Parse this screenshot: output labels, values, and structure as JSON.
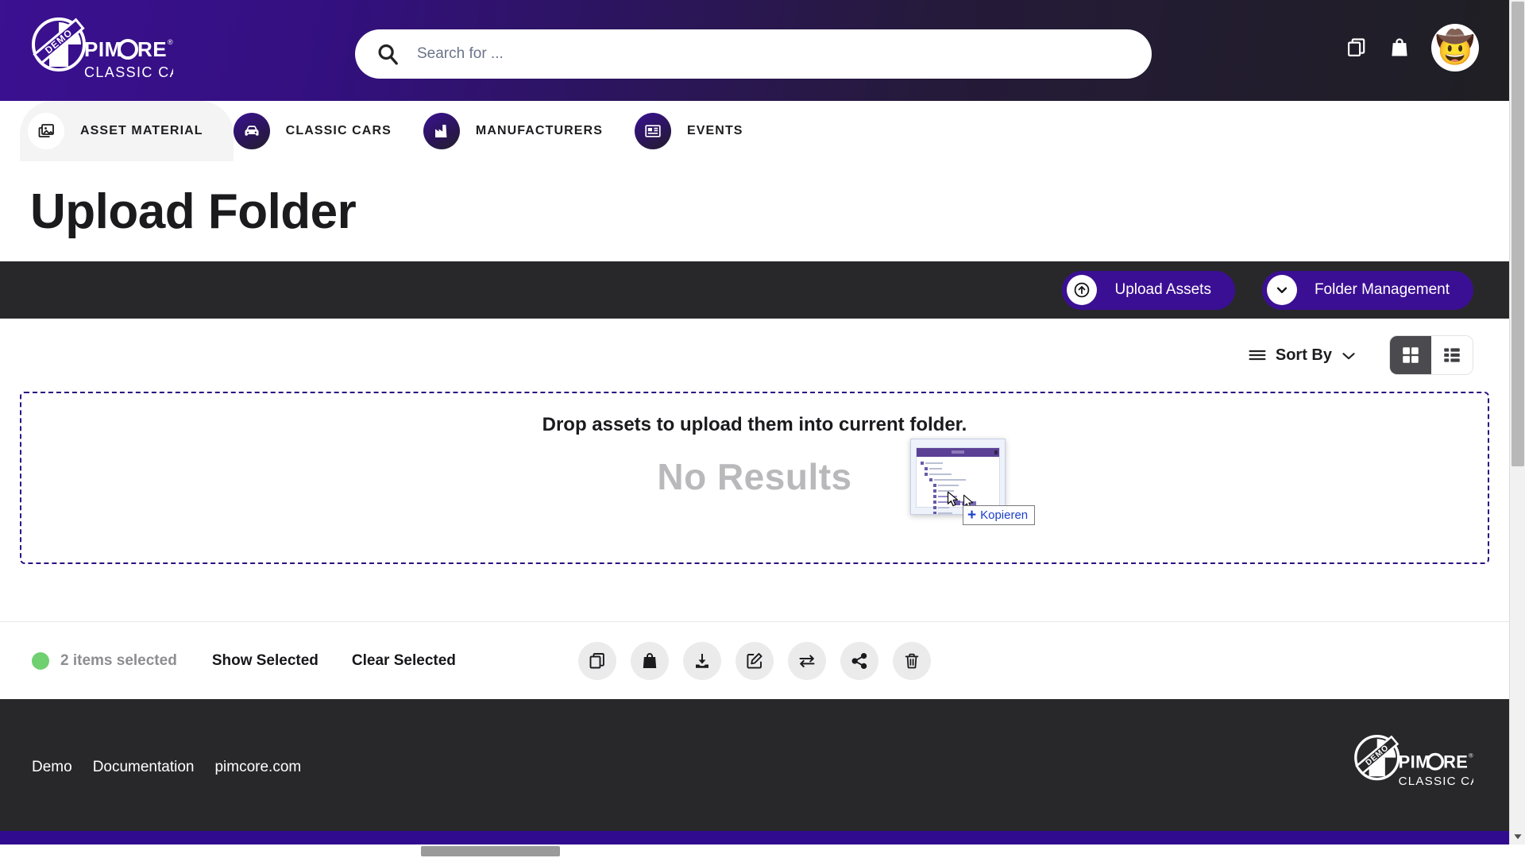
{
  "header": {
    "brand": {
      "badge": "DEMO",
      "name": "PIMCORE",
      "tagline": "CLASSIC CARS"
    },
    "search": {
      "value": "",
      "placeholder": "Search for ..."
    },
    "icons": [
      {
        "name": "copy-icon",
        "label": "Copy"
      },
      {
        "name": "bag-icon",
        "label": "Bag"
      }
    ],
    "avatar": {
      "name": "user-avatar",
      "emoji": "🤠"
    }
  },
  "nav": {
    "items": [
      {
        "label": "ASSET MATERIAL",
        "icon": "images-icon",
        "active": true
      },
      {
        "label": "CLASSIC CARS",
        "icon": "car-icon",
        "active": false
      },
      {
        "label": "MANUFACTURERS",
        "icon": "factory-icon",
        "active": false
      },
      {
        "label": "EVENTS",
        "icon": "newspaper-icon",
        "active": false
      }
    ]
  },
  "page": {
    "title": "Upload Folder"
  },
  "action_bar": {
    "upload_assets": {
      "label": "Upload Assets",
      "icon": "arrow-up-circle-icon"
    },
    "folder_management": {
      "label": "Folder Management",
      "icon": "chevron-down-circle-icon"
    },
    "accent_color": "#3b0f93"
  },
  "toolbar": {
    "sort_by": {
      "label": "Sort By",
      "icon": "bars-icon",
      "chevron": "chevron-down-icon"
    },
    "views": [
      {
        "name": "grid-view",
        "icon": "grid-icon",
        "active": true
      },
      {
        "name": "list-view",
        "icon": "list-icon",
        "active": false
      }
    ]
  },
  "dropzone": {
    "drop_text": "Drop assets to upload them into current folder.",
    "empty_text": "No Results",
    "border_color": "#2c1080"
  },
  "drag": {
    "drop_effect_label": "Kopieren",
    "plus": "+"
  },
  "selection_bar": {
    "count_text": "2 items selected",
    "dot_color": "#6fd06f",
    "show_selected": "Show Selected",
    "clear_selected": "Clear Selected",
    "actions": [
      {
        "name": "copy-action",
        "icon": "copy-icon"
      },
      {
        "name": "bag-action",
        "icon": "bag-icon"
      },
      {
        "name": "download-action",
        "icon": "download-icon"
      },
      {
        "name": "edit-action",
        "icon": "edit-icon"
      },
      {
        "name": "transfer-action",
        "icon": "transfer-icon"
      },
      {
        "name": "share-action",
        "icon": "share-icon"
      },
      {
        "name": "delete-action",
        "icon": "trash-icon"
      }
    ]
  },
  "footer": {
    "links": [
      {
        "label": "Demo"
      },
      {
        "label": "Documentation"
      },
      {
        "label": "pimcore.com"
      }
    ],
    "logo": {
      "badge": "DEMO",
      "name": "PIMCORE",
      "tagline": "CLASSIC CARS"
    },
    "background": "#28282b",
    "strip_color": "#300b90"
  }
}
